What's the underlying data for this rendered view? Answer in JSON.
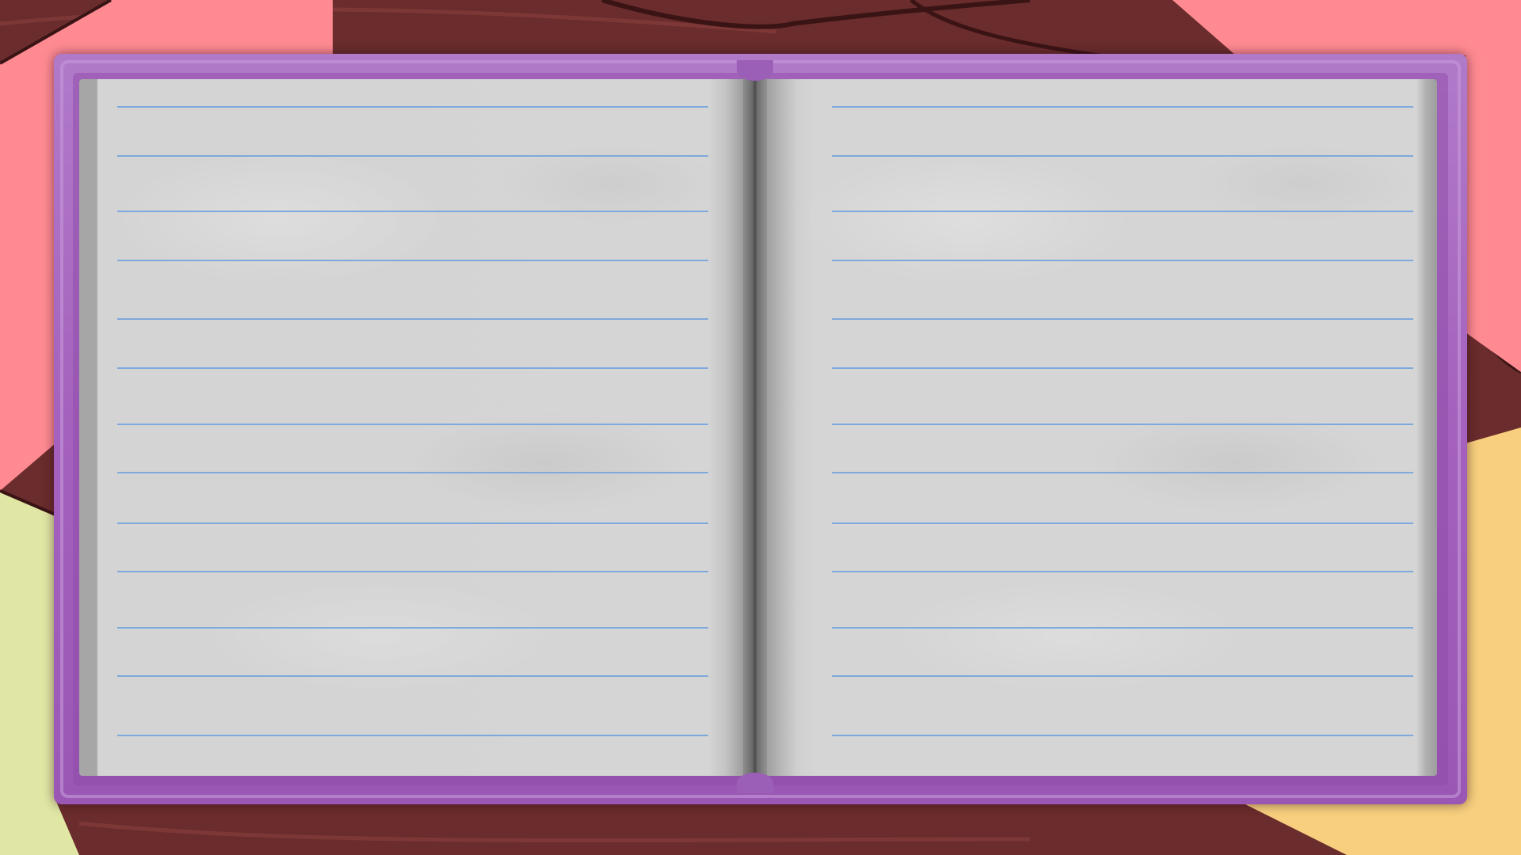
{
  "scene": {
    "type": "open-notebook",
    "left_page": {
      "ruled_lines": 14,
      "text": []
    },
    "right_page": {
      "ruled_lines": 14,
      "text": []
    }
  },
  "colors": {
    "cover": "#a461bd",
    "cover_dark": "#8e4ba8",
    "page": "#d5d5d5",
    "page_edge": "#a6a6a6",
    "rule": "#7ea9dc",
    "background_wood": "#6a2c2c",
    "sticky_pink": "#ff8a92",
    "sticky_yellow": "#f7cf7e",
    "sticky_green": "#e0e6a4"
  },
  "icons": [
    "notebook-icon"
  ]
}
